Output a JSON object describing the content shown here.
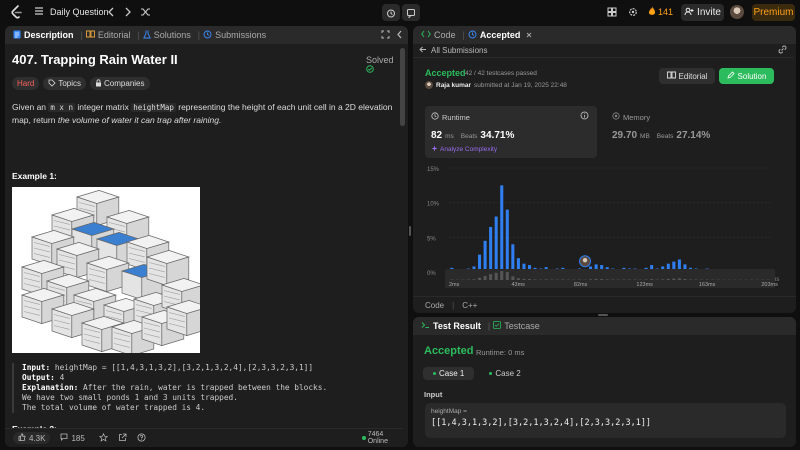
{
  "topbar": {
    "problem_list_label": "Daily Question",
    "streak": "141",
    "invite_label": "Invite",
    "premium_label": "Premium"
  },
  "left_panel": {
    "tabs": [
      {
        "label": "Description",
        "icon": "description-icon",
        "active": true
      },
      {
        "label": "Editorial",
        "icon": "book-icon",
        "active": false
      },
      {
        "label": "Solutions",
        "icon": "flask-icon",
        "active": false
      },
      {
        "label": "Submissions",
        "icon": "history-icon",
        "active": false
      }
    ],
    "title": "407. Trapping Rain Water II",
    "solved_label": "Solved",
    "chips": {
      "difficulty": "Hard",
      "topics": "Topics",
      "companies": "Companies"
    },
    "desc_1": "Given an",
    "desc_code_1": "m x n",
    "desc_2": "integer matrix",
    "desc_code_2": "heightMap",
    "desc_3": "representing the height of each unit cell in a 2D elevation map, return",
    "desc_4": "the volume of water it can trap after raining.",
    "example1_title": "Example 1:",
    "example1": {
      "input_label": "Input:",
      "input": "heightMap = [[1,4,3,1,3,2],[3,2,1,3,2,4],[2,3,3,2,3,1]]",
      "output_label": "Output:",
      "output": "4",
      "explanation_label": "Explanation:",
      "explanation_1": "After the rain, water is trapped between the blocks.",
      "explanation_2": "We have two small ponds 1 and 3 units trapped.",
      "explanation_3": "The total volume of water trapped is 4."
    },
    "example2_title": "Example 2:",
    "footer": {
      "likes": "4.3K",
      "comments": "185",
      "online": "7464 Online"
    }
  },
  "right_top": {
    "tabs": [
      {
        "label": "Code",
        "icon": "code-icon"
      },
      {
        "label": "Accepted",
        "icon": "history-icon"
      }
    ],
    "all_submissions": "All Submissions",
    "status": "Accepted",
    "testcases": "42 / 42 testcases passed",
    "user": "Raja kumar",
    "submitted": "submitted at Jan 19, 2025 22:48",
    "editorial_btn": "Editorial",
    "solution_btn": "Solution",
    "runtime": {
      "label": "Runtime",
      "value": "82",
      "unit": "ms",
      "beats_label": "Beats",
      "beats": "34.71%",
      "analyze": "Analyze Complexity"
    },
    "memory": {
      "label": "Memory",
      "value": "29.70",
      "unit": "MB",
      "beats_label": "Beats",
      "beats": "27.14%"
    },
    "lang_tabs": [
      "Code",
      "C++"
    ]
  },
  "chart_data": {
    "type": "bar",
    "ylabel": "",
    "xlabel": "",
    "ylim": [
      0,
      15
    ],
    "y_ticks": [
      "15%",
      "10%",
      "5%",
      "0%"
    ],
    "x_ticks": [
      "2ms",
      "42ms",
      "82ms",
      "123ms",
      "163ms",
      "203ms"
    ],
    "mini_x_ticks": [
      "2ms",
      "43ms",
      "82ms",
      "123ms",
      "163ms",
      "203ms"
    ],
    "values": [
      0.6,
      0.3,
      0.4,
      0.5,
      0.8,
      2.5,
      4.5,
      6.5,
      8.0,
      12.5,
      9.0,
      4.0,
      2.0,
      1.2,
      1.0,
      0.6,
      0.5,
      0.7,
      0.4,
      0.5,
      0.6,
      0.4,
      0.4,
      0.5,
      0.4,
      0.8,
      1.1,
      1.0,
      0.7,
      0.5,
      0.4,
      0.6,
      0.5,
      0.5,
      0.4,
      0.6,
      1.0,
      0.5,
      0.8,
      1.2,
      1.5,
      1.8,
      1.1,
      0.6,
      0.5,
      0.4,
      0.5,
      0.4,
      0.4,
      0.3,
      0.3,
      0.3,
      0.3,
      0.3,
      0.3,
      0.3,
      0.4,
      0.3
    ],
    "highlight_index": 24,
    "bar_color": "#2f7ff0"
  },
  "right_bottom": {
    "tabs": [
      {
        "label": "Test Result",
        "icon": "terminal-icon"
      },
      {
        "label": "Testcase",
        "icon": "check-icon"
      }
    ],
    "status": "Accepted",
    "runtime_label": "Runtime: 0 ms",
    "cases": [
      "Case 1",
      "Case 2"
    ],
    "input_label": "Input",
    "var_label": "heightMap =",
    "var_value": "[[1,4,3,1,3,2],[3,2,1,3,2,4],[2,3,3,2,3,1]]"
  }
}
